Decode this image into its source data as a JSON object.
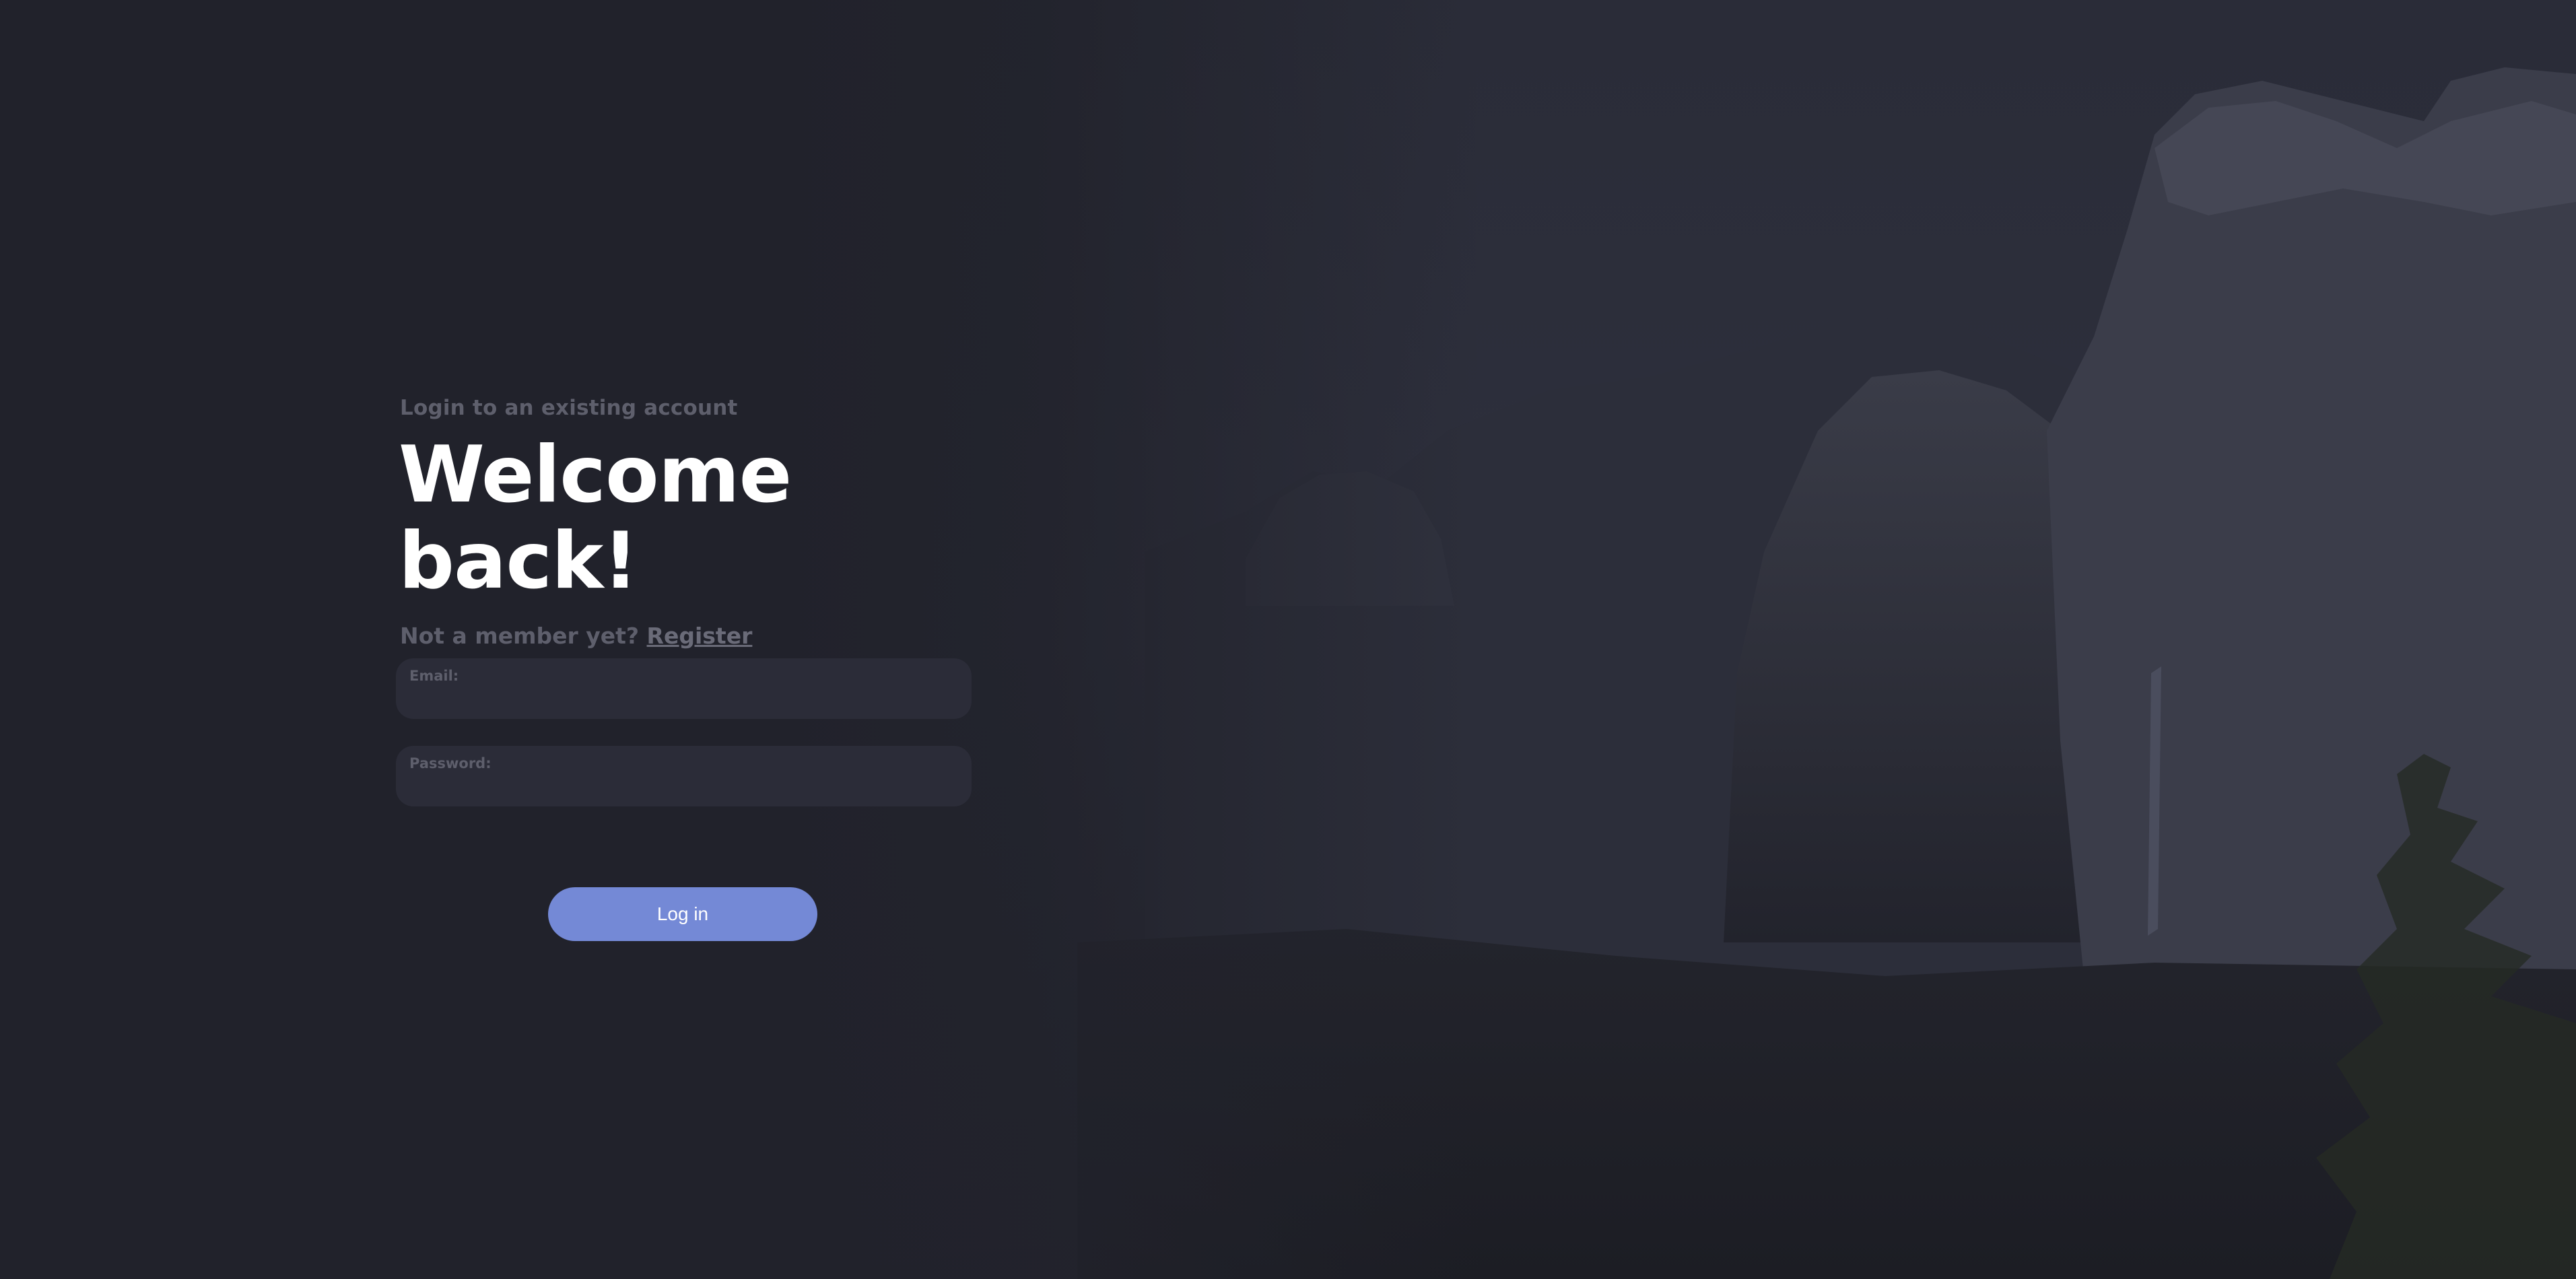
{
  "login": {
    "subtitle": "Login to an existing account",
    "title": "Welcome back!",
    "not_member_text": "Not a member yet?",
    "register_link": "Register",
    "email_label": "Email:",
    "email_value": "",
    "password_label": "Password:",
    "password_value": "",
    "submit_label": "Log in"
  },
  "colors": {
    "background": "#21222b",
    "field_background": "#2b2c38",
    "accent": "#7489d6",
    "muted_text": "#5e5f6c",
    "title_text": "#ffffff"
  }
}
